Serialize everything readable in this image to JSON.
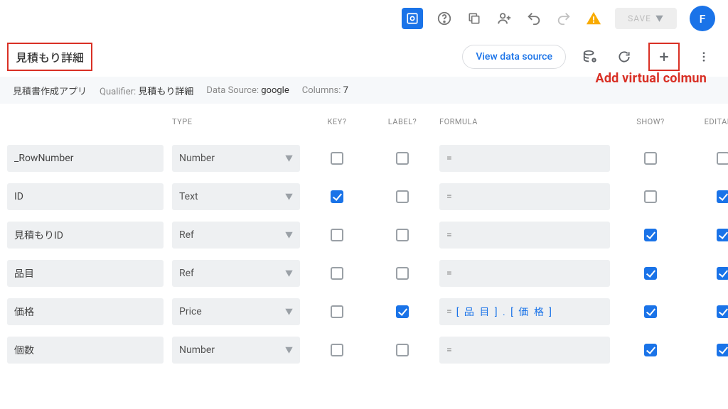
{
  "topbar": {
    "save_label": "SAVE",
    "avatar_letter": "F"
  },
  "tableName": "見積もり詳細",
  "viewDataSource": "View data source",
  "annotation": "Add virtual colmun",
  "info": {
    "appName": "見積書作成アプリ",
    "qualifierLabel": "Qualifier:",
    "qualifierValue": "見積もり詳細",
    "dataSourceLabel": "Data Source:",
    "dataSourceValue": "google",
    "columnsLabel": "Columns:",
    "columnsValue": "7"
  },
  "headers": {
    "type": "TYPE",
    "key": "KEY?",
    "label": "LABEL?",
    "formula": "FORMULA",
    "show": "SHOW?",
    "editable": "EDITABLE"
  },
  "columns": [
    {
      "name": "_RowNumber",
      "type": "Number",
      "key": false,
      "label": false,
      "formula": "",
      "show": false,
      "editable": false
    },
    {
      "name": "ID",
      "type": "Text",
      "key": true,
      "label": false,
      "formula": "",
      "show": false,
      "editable": true
    },
    {
      "name": "見積もりID",
      "type": "Ref",
      "key": false,
      "label": false,
      "formula": "",
      "show": true,
      "editable": true
    },
    {
      "name": "品目",
      "type": "Ref",
      "key": false,
      "label": false,
      "formula": "",
      "show": true,
      "editable": true
    },
    {
      "name": "価格",
      "type": "Price",
      "key": false,
      "label": true,
      "formula": "[品目].[価格]",
      "show": true,
      "editable": true
    },
    {
      "name": "個数",
      "type": "Number",
      "key": false,
      "label": false,
      "formula": "",
      "show": true,
      "editable": true
    }
  ]
}
